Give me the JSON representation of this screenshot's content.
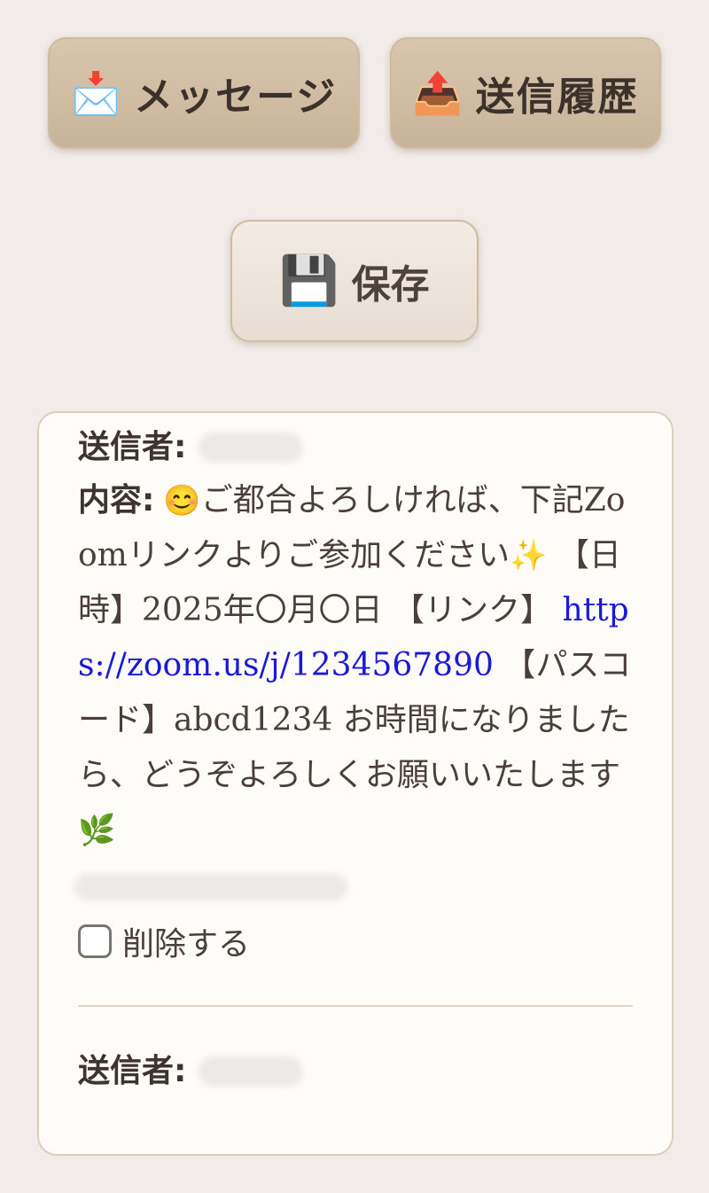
{
  "tabs": {
    "messages": {
      "icon": "📩",
      "icon_name": "incoming-envelope-icon",
      "label": "メッセージ"
    },
    "history": {
      "icon": "📤",
      "icon_name": "outbox-tray-icon",
      "label": "送信履歴"
    }
  },
  "save": {
    "icon": "💾",
    "icon_name": "floppy-disk-icon",
    "label": "保存"
  },
  "messages": [
    {
      "sender_label": "送信者:",
      "content_label": "内容:",
      "content_emoji_start": "😊",
      "content_part1": "ご都合よろしければ、下記Zoomリンクよりご参加ください",
      "content_emoji_sparkle": "✨",
      "content_part2": " 【日時】2025年〇月〇日 【リンク】 ",
      "link": "https://zoom.us/j/1234567890",
      "content_part3": " 【パスコード】abcd1234 お時間になりましたら、どうぞよろしくお願いいたします",
      "content_emoji_end": "🌿",
      "delete_label": "削除する",
      "delete_checked": false
    },
    {
      "sender_label": "送信者:"
    }
  ],
  "colors": {
    "page_background": "#f1ecea",
    "tab_background": "#c8b498",
    "card_background": "#fefcf9",
    "link": "#1a1ad6",
    "text": "#4a4039"
  }
}
